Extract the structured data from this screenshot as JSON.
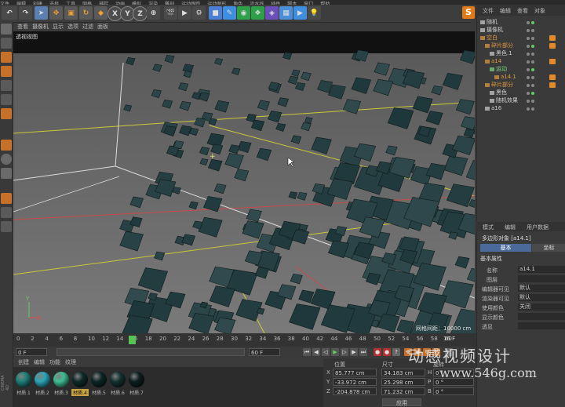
{
  "menubar": {
    "items": [
      "文件",
      "编辑",
      "创建",
      "选择",
      "工具",
      "网格",
      "捕捉",
      "动画",
      "模拟",
      "渲染",
      "雕刻",
      "运动跟踪",
      "运动图形",
      "角色",
      "流水线",
      "插件",
      "脚本",
      "窗口",
      "帮助"
    ]
  },
  "toolbar": {
    "undo": "↶",
    "axis_x": "X",
    "axis_y": "Y",
    "axis_z": "Z"
  },
  "viewport": {
    "menu": [
      "查看",
      "摄像机",
      "显示",
      "选项",
      "过滤",
      "面板"
    ],
    "label": "透视视图",
    "grid_readout": "网格间距：10000 cm",
    "axis_y": "Y",
    "axis_x": "X"
  },
  "timeline": {
    "ticks": [
      "0",
      "2",
      "4",
      "6",
      "8",
      "10",
      "12",
      "14",
      "16",
      "18",
      "20",
      "22",
      "24",
      "26",
      "28",
      "30",
      "32",
      "34",
      "36",
      "38",
      "40",
      "42",
      "44",
      "46",
      "48",
      "50",
      "52",
      "54",
      "56",
      "58",
      "60"
    ],
    "current_frame": "16 F",
    "start_field": "0 F",
    "end_field": "60 F"
  },
  "material_manager": {
    "menu": [
      "创建",
      "编辑",
      "功能",
      "纹理"
    ],
    "materials": [
      {
        "label": "材质.1",
        "color": "#1d7f78"
      },
      {
        "label": "材质.2",
        "color": "#2aa6b8"
      },
      {
        "label": "材质.3",
        "color": "#3ebd92"
      },
      {
        "label": "材质.4",
        "color": "#0f2a28"
      },
      {
        "label": "材质.5",
        "color": "#0d2626"
      },
      {
        "label": "材质.6",
        "color": "#133330"
      },
      {
        "label": "材质.7",
        "color": "#0e1f1f"
      }
    ]
  },
  "coordinates": {
    "pos_header": "位置",
    "size_header": "尺寸",
    "rot_header": "旋转",
    "rows": [
      {
        "axis": "X",
        "pos": "85.777 cm",
        "size": "34.183 cm",
        "rot_axis": "H",
        "rot": "0 °"
      },
      {
        "axis": "Y",
        "pos": "-33.972 cm",
        "size": "25.298 cm",
        "rot_axis": "P",
        "rot": "0 °"
      },
      {
        "axis": "Z",
        "pos": "-204.878 cm",
        "size": "71.232 cm",
        "rot_axis": "B",
        "rot": "0 °"
      }
    ],
    "apply_label": "应用"
  },
  "object_manager": {
    "tabs": [
      "文件",
      "编辑",
      "查看",
      "对象"
    ],
    "rows": [
      {
        "name": "随机",
        "indent": 0,
        "color": "#d0d0d0"
      },
      {
        "name": "摄像机",
        "indent": 0,
        "color": "#d0d0d0"
      },
      {
        "name": "空白",
        "indent": 0,
        "color": "#e39b3f"
      },
      {
        "name": "碎片部分",
        "indent": 1,
        "color": "#e39b3f"
      },
      {
        "name": "黑色.1",
        "indent": 2,
        "color": "#d0d0d0"
      },
      {
        "name": "a14",
        "indent": 1,
        "color": "#e39b3f"
      },
      {
        "name": "运动",
        "indent": 2,
        "color": "#7fd97f"
      },
      {
        "name": "a14.1",
        "indent": 3,
        "color": "#e39b3f"
      },
      {
        "name": "碎片部分",
        "indent": 1,
        "color": "#e39b3f"
      },
      {
        "name": "黑色",
        "indent": 2,
        "color": "#d0d0d0"
      },
      {
        "name": "随机效果",
        "indent": 2,
        "color": "#d0d0d0"
      },
      {
        "name": "a16",
        "indent": 1,
        "color": "#d0d0d0"
      }
    ]
  },
  "attribute_manager": {
    "tabs": [
      "模式",
      "编辑",
      "用户数据"
    ],
    "object_title": "多边形对象 [a14.1]",
    "sub_tabs": [
      "基本",
      "坐标"
    ],
    "section": "基本属性",
    "fields": [
      {
        "label": "名称",
        "value": "a14.1"
      },
      {
        "label": "图层",
        "value": ""
      },
      {
        "label": "编辑器可见",
        "value": "默认"
      },
      {
        "label": "渲染器可见",
        "value": "默认"
      },
      {
        "label": "使用颜色",
        "value": "关闭"
      },
      {
        "label": "显示颜色",
        "value": ""
      },
      {
        "label": "透显",
        "value": ""
      }
    ]
  },
  "watermark": {
    "line1": "动感视频设计",
    "line2": "www.546g.com"
  },
  "side_label": "CINEMA 4D"
}
